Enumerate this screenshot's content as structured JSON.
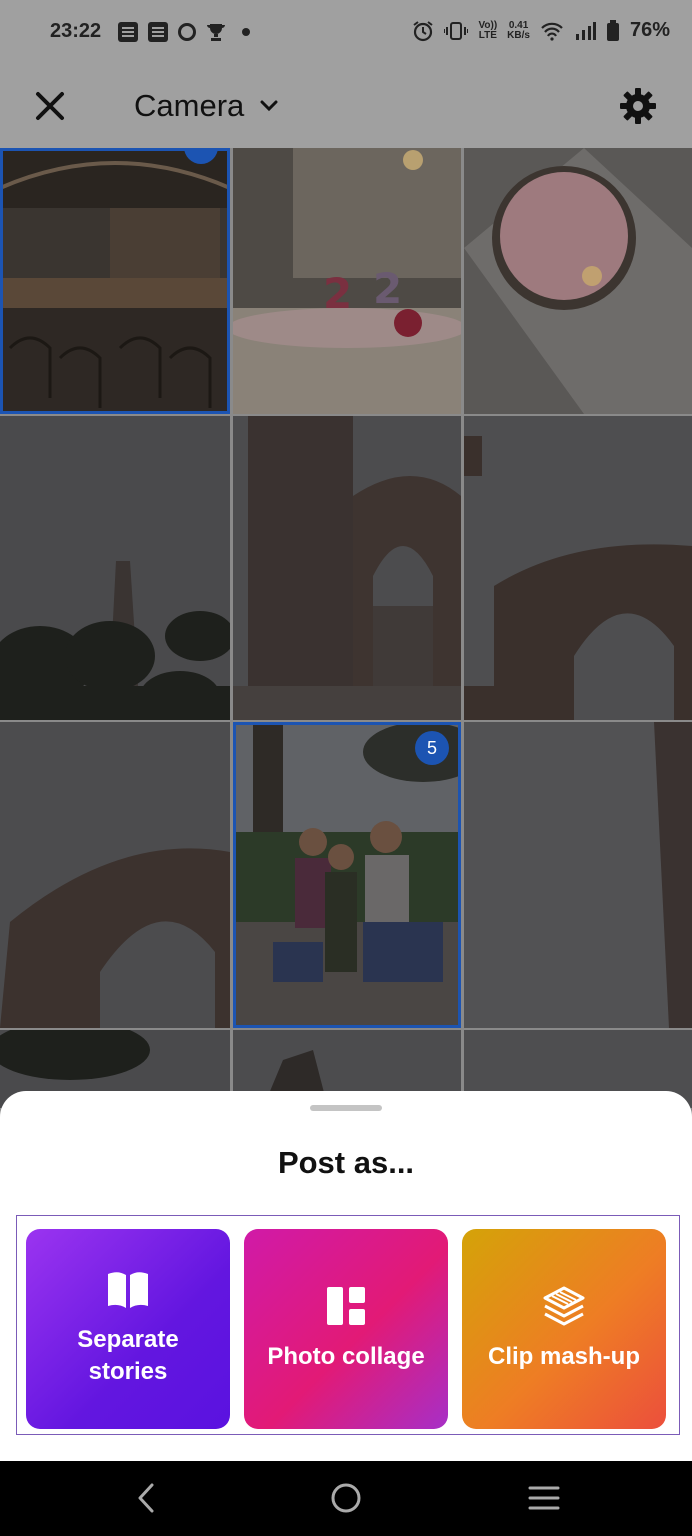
{
  "status_bar": {
    "time": "23:22",
    "net_speed_value": "0.41",
    "net_speed_unit": "KB/s",
    "volte_top": "Vo))",
    "volte_bottom": "LTE",
    "battery_percent": "76%"
  },
  "header": {
    "title": "Camera"
  },
  "gallery": {
    "selected_badge": "5"
  },
  "sheet": {
    "title": "Post as...",
    "options": [
      {
        "line1": "Separate",
        "line2": "stories"
      },
      {
        "line1": "Photo collage"
      },
      {
        "line1": "Clip mash-up"
      }
    ]
  },
  "colors": {
    "selection_blue": "#1c54b2",
    "separate_gradient": [
      "#9b34f0",
      "#5a12e0"
    ],
    "collage_gradient": [
      "#d01aa8",
      "#e21a76"
    ],
    "clip_gradient": [
      "#d4a308",
      "#ec4f3c"
    ]
  }
}
